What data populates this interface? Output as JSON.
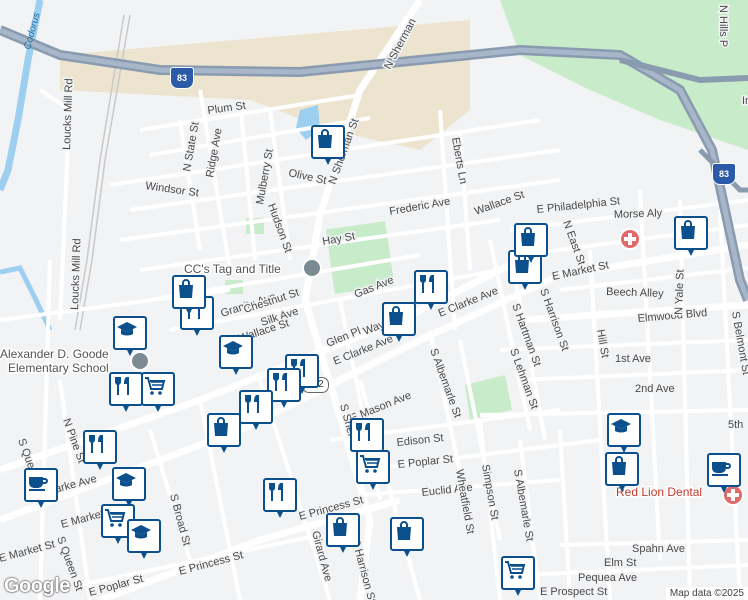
{
  "map": {
    "attribution": "Map data ©2025",
    "google_logo": "Google",
    "colors": {
      "background": "#f2f3f5",
      "road": "#ffffff",
      "highway": "#8a9bb0",
      "park": "#c8ebc9",
      "water": "#9ccff0",
      "industrial": "#ece4cf",
      "pin_border": "#0b4f8c"
    }
  },
  "highways": {
    "shield_83": "83",
    "route_462": "462"
  },
  "places": {
    "tag_title": "CC's Tag and Title",
    "school_line1": "Alexander D. Goode",
    "school_line2": "Elementary School",
    "dental": "Red Lion Dental"
  },
  "water": {
    "codorus": "Codorus"
  },
  "streets": {
    "n_sherman_st_top": "N Sherman",
    "n_sherman_st": "N Sherman St",
    "plum_st": "Plum St",
    "n_state_st": "N State St",
    "ridge_ave": "Ridge Ave",
    "mulberry_st": "Mulberry St",
    "olive_st": "Olive St",
    "windsor_st": "Windsor St",
    "hudson_st": "Hudson St",
    "hay_st": "Hay St",
    "frederic_ave": "Frederic Ave",
    "eberts_ln": "Eberts Ln",
    "wallace_st_top": "Wallace St",
    "e_philadelphia_st": "E Philadelphia St",
    "morse_aly": "Morse Aly",
    "n_east_st": "N East St",
    "n_hills_top": "N Hills P",
    "e_market_st": "E Market St",
    "beech_alley": "Beech Alley",
    "elmwood_blvd": "Elmwood Blvd",
    "gas_ave": "Gas Ave",
    "granite_ave": "Granite Ave",
    "chestnut_st": "Chestnut St",
    "silk_ave": "Silk Ave",
    "wallace_st": "Wallace St",
    "glen_pl": "Glen Pl",
    "wayne_ave": "Wayne",
    "e_clarke_ave": "E Clarke Ave",
    "s_hartman_st": "S Hartman St",
    "s_harrison_st": "S Harrison St",
    "s_lehman_st": "S Lehman St",
    "hill_st": "Hill St",
    "n_yale_st": "N Yale St",
    "s_belmont_st": "S Belmont St",
    "first_ave": "1st Ave",
    "second_ave": "2nd Ave",
    "e_mason_ave": "E Mason Ave",
    "s_albemarle_st": "S Albemarle St",
    "edison_st": "Edison St",
    "e_poplar_st": "E Poplar St",
    "loucks_mill_rd": "Loucks Mill Rd",
    "n_pine_st": "N Pine St",
    "s_queen_st": "S Queen St",
    "e_clarke_ave_w": "E Clarke Ave",
    "e_market_st_w": "E Market St",
    "s_broad_st": "S Broad St",
    "e_princess_st": "E Princess St",
    "girard_ave": "Girard Ave",
    "s_harrison_st_s": "S Harrison St",
    "euclid_ave": "Euclid Ave",
    "wheatfield_st": "Wheatfield St",
    "simpson_st": "Simpson St",
    "spahn_ave": "Spahn Ave",
    "elm_st": "Elm St",
    "pequea_ave": "Pequea Ave",
    "e_prospect_st": "E Prospect St",
    "e_poplar_st_w": "E Poplar St",
    "st_fifth": "5th",
    "ind_label": "In",
    "s_sherman": "S Sher"
  },
  "pins": [
    {
      "type": "shopping-bag"
    },
    {
      "type": "restaurant"
    },
    {
      "type": "shopping-bag"
    },
    {
      "type": "school"
    },
    {
      "type": "restaurant"
    },
    {
      "type": "school"
    },
    {
      "type": "restaurant"
    },
    {
      "type": "shopping-cart"
    },
    {
      "type": "restaurant"
    },
    {
      "type": "restaurant"
    },
    {
      "type": "shopping-bag"
    },
    {
      "type": "restaurant"
    },
    {
      "type": "shopping-bag"
    },
    {
      "type": "restaurant"
    },
    {
      "type": "school"
    },
    {
      "type": "cafe"
    },
    {
      "type": "shopping-cart"
    },
    {
      "type": "school"
    },
    {
      "type": "restaurant"
    },
    {
      "type": "shopping-bag"
    },
    {
      "type": "shopping-bag"
    },
    {
      "type": "shopping-cart"
    },
    {
      "type": "restaurant"
    },
    {
      "type": "shopping-bag"
    },
    {
      "type": "school"
    },
    {
      "type": "shopping-bag"
    },
    {
      "type": "cafe"
    },
    {
      "type": "shopping-cart"
    },
    {
      "type": "shopping-bag"
    },
    {
      "type": "shopping-bag"
    }
  ]
}
